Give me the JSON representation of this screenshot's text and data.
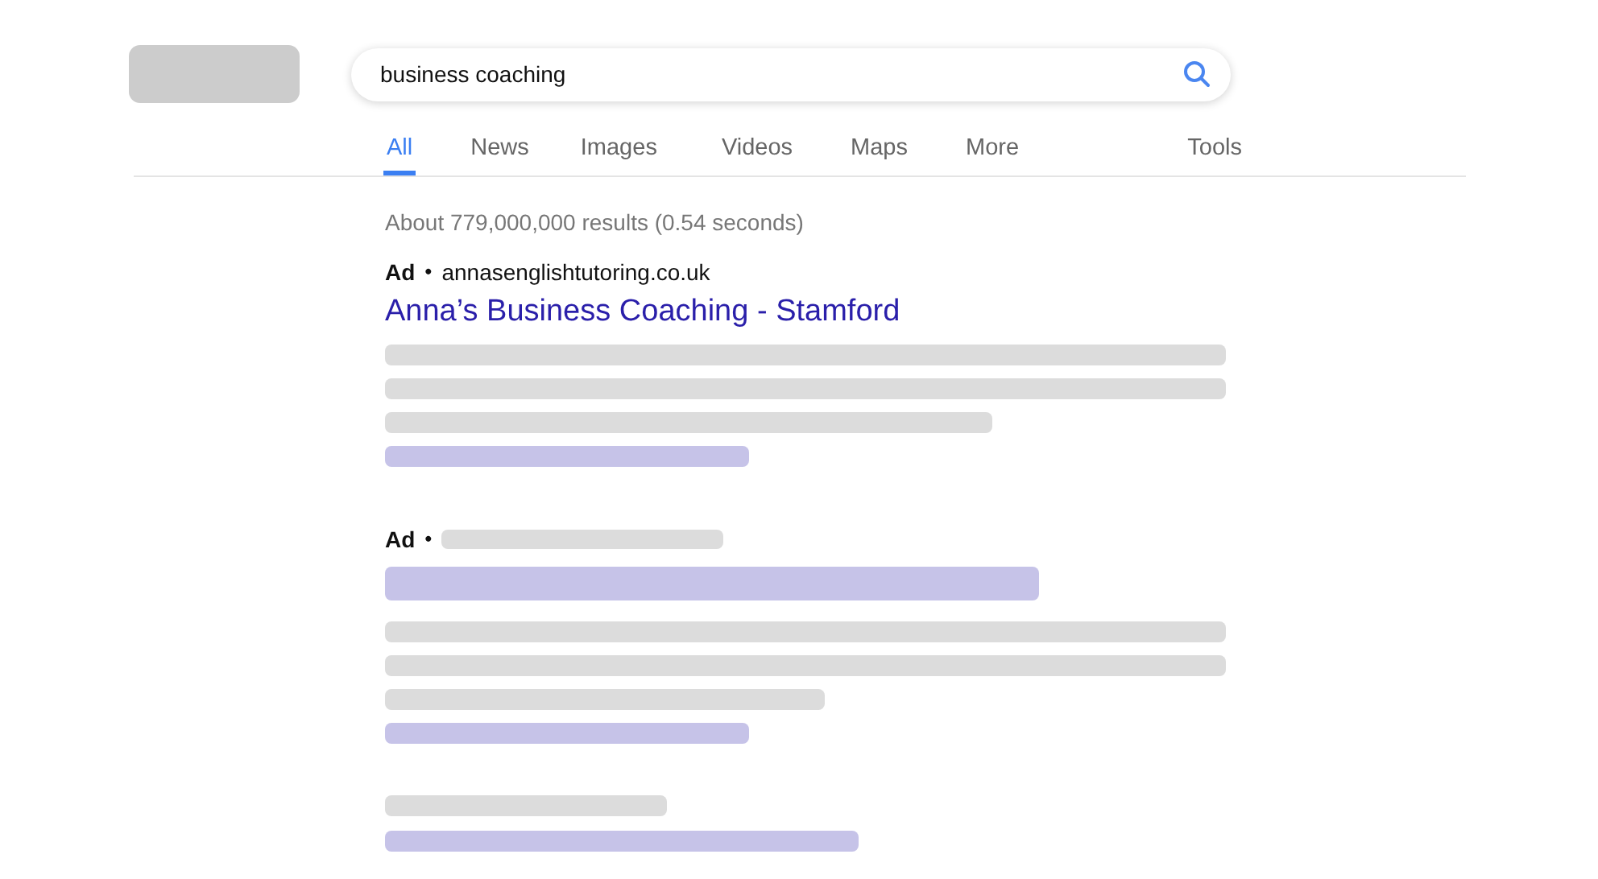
{
  "search": {
    "value": "business coaching"
  },
  "tabs": [
    {
      "label": "All",
      "selected": true
    },
    {
      "label": "News",
      "selected": false
    },
    {
      "label": "Images",
      "selected": false
    },
    {
      "label": "Videos",
      "selected": false
    },
    {
      "label": "Maps",
      "selected": false
    },
    {
      "label": "More",
      "selected": false
    }
  ],
  "tools": "Tools",
  "result_stats": "About 779,000,000 results (0.54 seconds)",
  "results": [
    {
      "ad_label": "Ad",
      "separator": "•",
      "url": "annasenglishtutoring.co.uk",
      "title": "Anna’s Business Coaching - Stamford"
    },
    {
      "ad_label": "Ad",
      "separator": "•"
    }
  ]
}
